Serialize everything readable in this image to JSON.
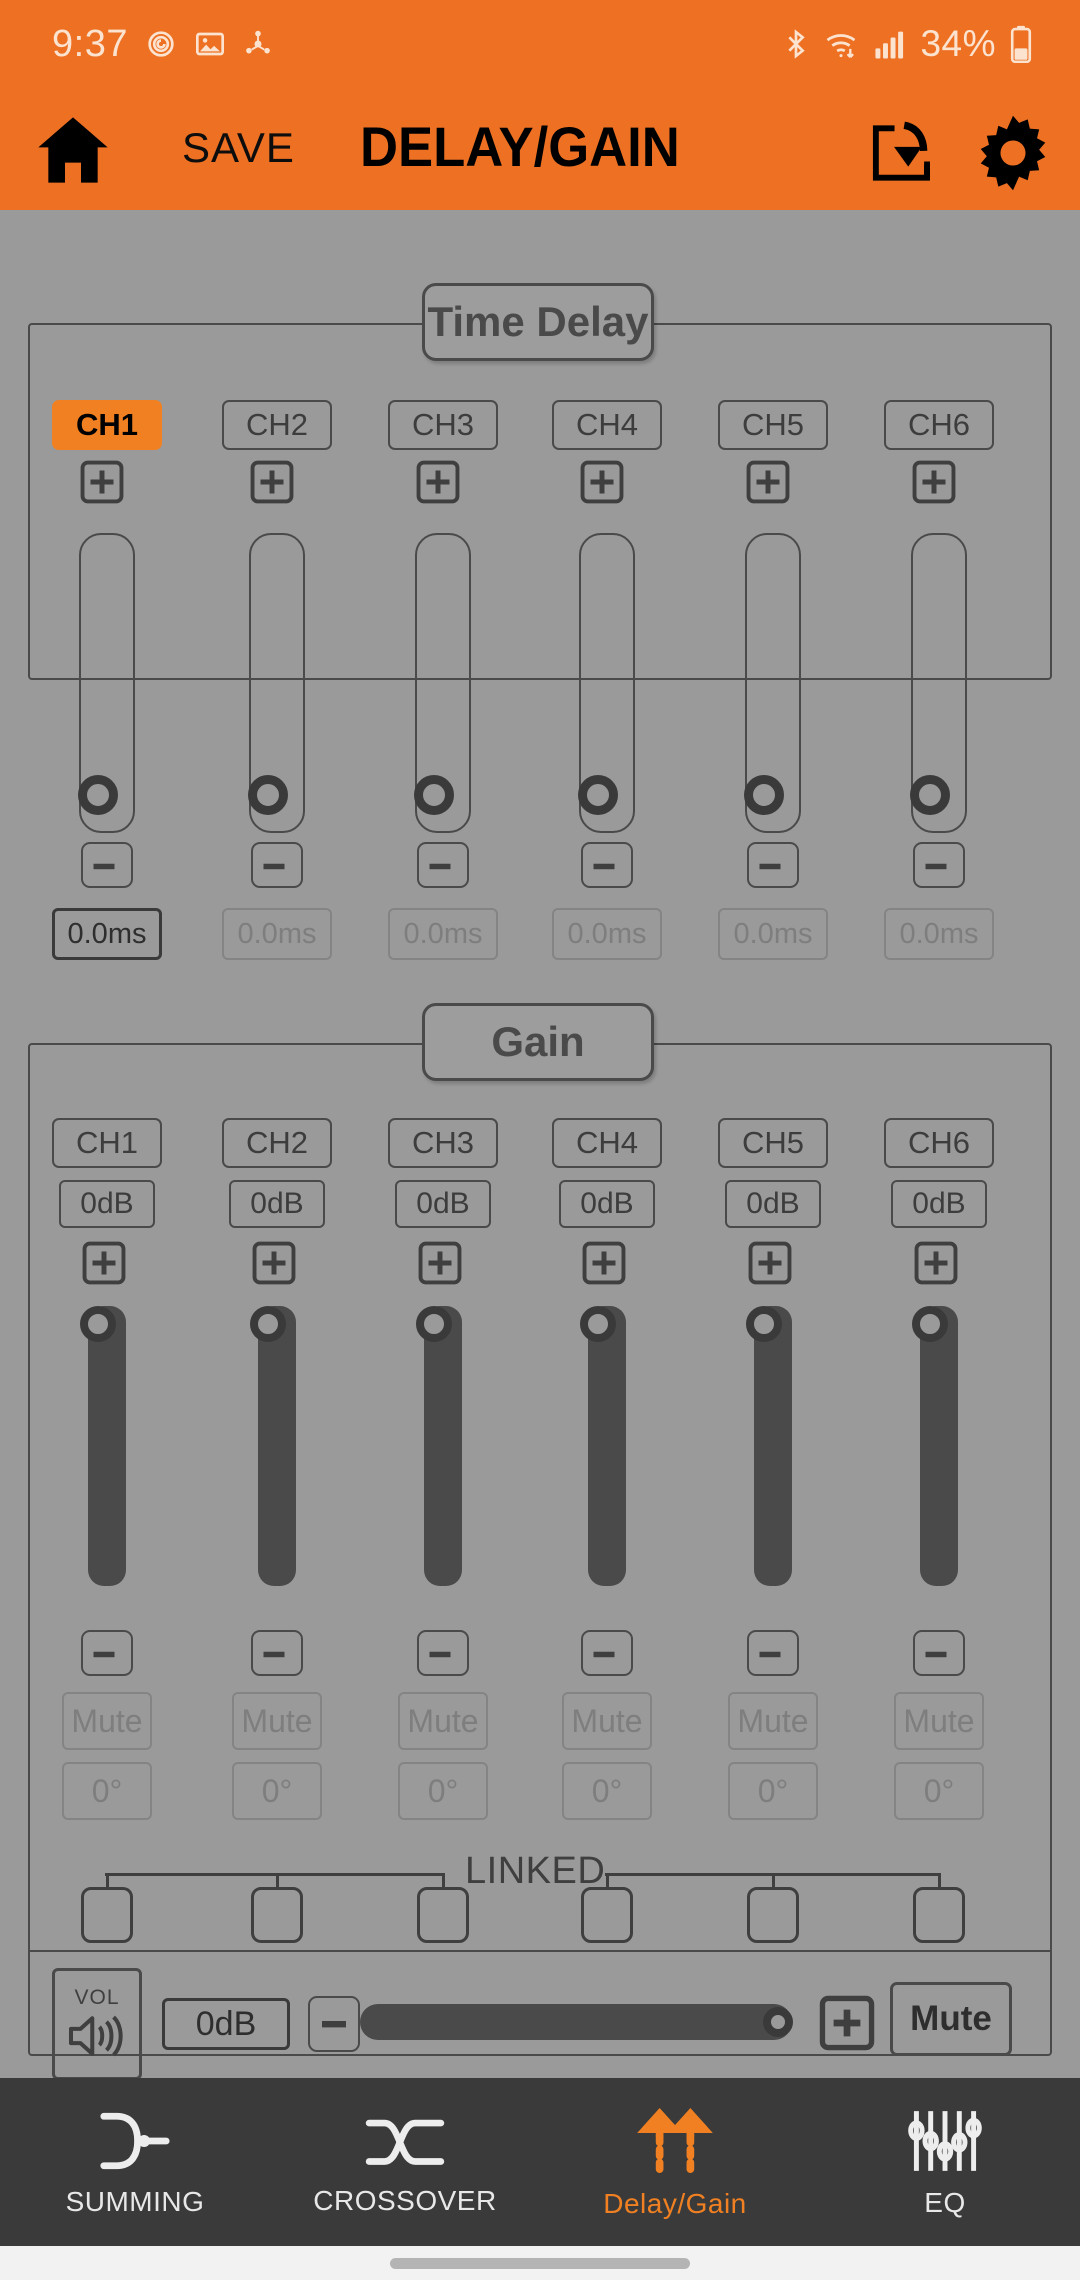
{
  "statusbar": {
    "time": "9:37",
    "battery_percent": "34%",
    "icons": [
      "alarm-icon",
      "screenshot-icon",
      "network-share-icon",
      "bluetooth-icon",
      "wifi-icon",
      "cellular-signal-icon",
      "battery-icon"
    ]
  },
  "appbar": {
    "home_label": "home-icon",
    "save_label": "SAVE",
    "title": "DELAY/GAIN",
    "load_label": "load-icon",
    "settings_label": "gear-icon"
  },
  "time_delay": {
    "title": "Time Delay",
    "active_channel": "CH1",
    "channels": [
      {
        "name": "CH1",
        "value": "0.0ms",
        "selected": true,
        "knob_pct": 100
      },
      {
        "name": "CH2",
        "value": "0.0ms",
        "selected": false,
        "knob_pct": 100
      },
      {
        "name": "CH3",
        "value": "0.0ms",
        "selected": false,
        "knob_pct": 100
      },
      {
        "name": "CH4",
        "value": "0.0ms",
        "selected": false,
        "knob_pct": 100
      },
      {
        "name": "CH5",
        "value": "0.0ms",
        "selected": false,
        "knob_pct": 100
      },
      {
        "name": "CH6",
        "value": "0.0ms",
        "selected": false,
        "knob_pct": 100
      }
    ],
    "plus_label": "plus-icon",
    "minus_label": "minus-icon"
  },
  "gain": {
    "title": "Gain",
    "channels": [
      {
        "name": "CH1",
        "db": "0dB",
        "mute": "Mute",
        "phase": "0°",
        "knob_pct": 0,
        "linked": false
      },
      {
        "name": "CH2",
        "db": "0dB",
        "mute": "Mute",
        "phase": "0°",
        "knob_pct": 0,
        "linked": false
      },
      {
        "name": "CH3",
        "db": "0dB",
        "mute": "Mute",
        "phase": "0°",
        "knob_pct": 0,
        "linked": false
      },
      {
        "name": "CH4",
        "db": "0dB",
        "mute": "Mute",
        "phase": "0°",
        "knob_pct": 0,
        "linked": false
      },
      {
        "name": "CH5",
        "db": "0dB",
        "mute": "Mute",
        "phase": "0°",
        "knob_pct": 0,
        "linked": false
      },
      {
        "name": "CH6",
        "db": "0dB",
        "mute": "Mute",
        "phase": "0°",
        "knob_pct": 0,
        "linked": false
      }
    ],
    "linked_label": "LINKED"
  },
  "master_volume": {
    "vol_label": "VOL",
    "db": "0dB",
    "minus_label": "minus-icon",
    "plus_label": "plus-icon",
    "mute_label": "Mute",
    "slider_pct": 100
  },
  "bottom_nav": {
    "items": [
      {
        "label": "SUMMING",
        "icon": "summing-icon",
        "active": false
      },
      {
        "label": "CROSSOVER",
        "icon": "crossover-icon",
        "active": false
      },
      {
        "label": "Delay/Gain",
        "icon": "delay-gain-icon",
        "active": true
      },
      {
        "label": "EQ",
        "icon": "eq-icon",
        "active": false
      }
    ]
  },
  "colors": {
    "accent": "#ED7023",
    "accent_button": "#F08021",
    "background": "#9a9a9a",
    "outline": "#4a4a4a",
    "nav_background": "#3a3a3a"
  }
}
